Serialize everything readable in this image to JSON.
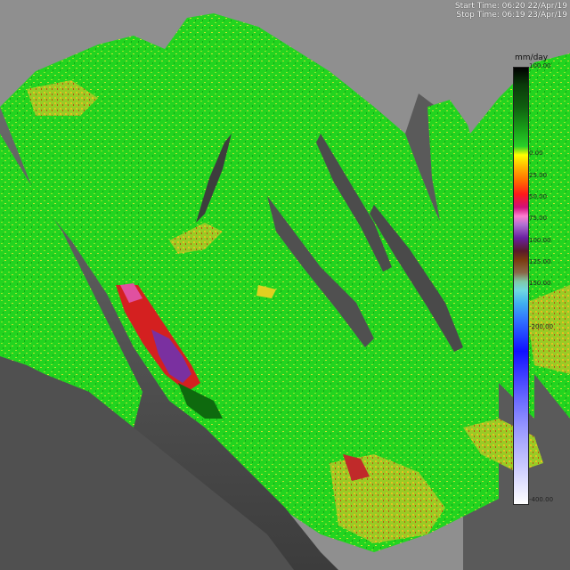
{
  "info": {
    "start_time": "Start Time: 06:20 22/Apr/19",
    "stop_time": "Stop Time: 06:19 23/Apr/19"
  },
  "legend": {
    "unit": "mm/day",
    "ticks": [
      "100.00",
      "0.00",
      "25.00",
      "50.00",
      "75.00",
      "100.00",
      "125.00",
      "150.00",
      "-200.00",
      "-400.00"
    ]
  },
  "colors": {
    "sky": "#8f8f8f",
    "terrain_green": "#22d41f",
    "rock_dark": "#4a4a4a",
    "highlight_red": "#d42020",
    "highlight_purple": "#7a30a0"
  }
}
